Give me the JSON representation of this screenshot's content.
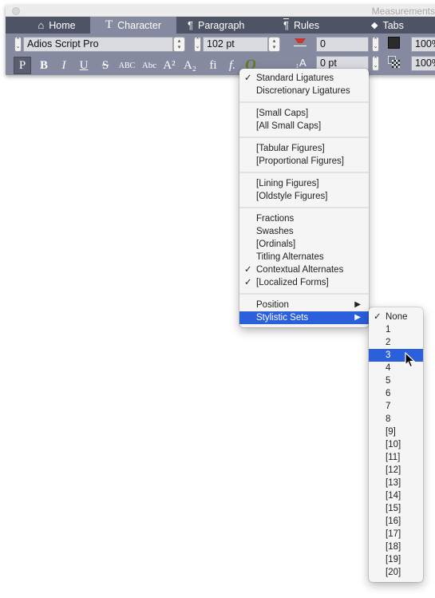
{
  "window": {
    "title": "Measurements"
  },
  "tabs": [
    {
      "label": "Home",
      "icon": "house-icon",
      "active": false
    },
    {
      "label": "Character",
      "icon": "type-tool-icon",
      "active": true
    },
    {
      "label": "Paragraph",
      "icon": "pilcrow-icon",
      "active": false
    },
    {
      "label": "Rules",
      "icon": "paragraph-rules-icon",
      "active": false
    },
    {
      "label": "Tabs",
      "icon": "tab-marker-icon",
      "active": false
    }
  ],
  "toolbar": {
    "font_family": "Adios Script Pro",
    "font_size": "102 pt",
    "tracking": "0",
    "baseline_shift": "0 pt",
    "color_opacity": "100%",
    "shade_opacity": "100%",
    "styles": [
      {
        "label": "P",
        "name": "plain-button",
        "active": true
      },
      {
        "label": "B",
        "name": "bold-button"
      },
      {
        "label": "I",
        "name": "italic-button"
      },
      {
        "label": "U",
        "name": "underline-button"
      },
      {
        "label": "S",
        "name": "strikethrough-button"
      },
      {
        "label": "ABC",
        "name": "all-caps-button"
      },
      {
        "label": "Abc",
        "name": "small-caps-button"
      },
      {
        "label": "A²",
        "name": "superscript-button"
      },
      {
        "label": "A₂",
        "name": "subscript-button"
      },
      {
        "label": "fi",
        "name": "ligatures-button"
      },
      {
        "label": "f.",
        "name": "opentype-menu-button"
      }
    ]
  },
  "opentype_menu": {
    "groups": [
      [
        {
          "label": "Standard Ligatures",
          "checked": true
        },
        {
          "label": "Discretionary Ligatures"
        }
      ],
      [
        {
          "label": "[Small Caps]"
        },
        {
          "label": "[All Small Caps]"
        }
      ],
      [
        {
          "label": "[Tabular Figures]"
        },
        {
          "label": "[Proportional Figures]"
        }
      ],
      [
        {
          "label": "[Lining Figures]"
        },
        {
          "label": "[Oldstyle Figures]"
        }
      ],
      [
        {
          "label": "Fractions"
        },
        {
          "label": "Swashes"
        },
        {
          "label": "[Ordinals]"
        },
        {
          "label": "Titling Alternates"
        },
        {
          "label": "Contextual Alternates",
          "checked": true
        },
        {
          "label": "[Localized Forms]",
          "checked": true
        }
      ],
      [
        {
          "label": "Position",
          "submenu": true
        },
        {
          "label": "Stylistic Sets",
          "submenu": true,
          "highlighted": true
        }
      ]
    ]
  },
  "stylistic_sets_menu": {
    "items": [
      {
        "label": "None",
        "checked": true
      },
      {
        "label": "1"
      },
      {
        "label": "2"
      },
      {
        "label": "3",
        "highlighted": true
      },
      {
        "label": "4"
      },
      {
        "label": "5"
      },
      {
        "label": "6"
      },
      {
        "label": "7"
      },
      {
        "label": "8"
      },
      {
        "label": "[9]"
      },
      {
        "label": "[10]"
      },
      {
        "label": "[11]"
      },
      {
        "label": "[12]"
      },
      {
        "label": "[13]"
      },
      {
        "label": "[14]"
      },
      {
        "label": "[15]"
      },
      {
        "label": "[16]"
      },
      {
        "label": "[17]"
      },
      {
        "label": "[18]"
      },
      {
        "label": "[19]"
      },
      {
        "label": "[20]"
      }
    ]
  },
  "glyphs": {
    "check": "✓",
    "submenu_arrow": "▶",
    "stepper": "⌃⌄",
    "popup": "▴▾"
  },
  "colors": {
    "highlight": "#2b5fdb",
    "tab_bar": "#4f5366",
    "toolbar": "#868aa0",
    "opentype_icon": "#5d7d1e"
  }
}
